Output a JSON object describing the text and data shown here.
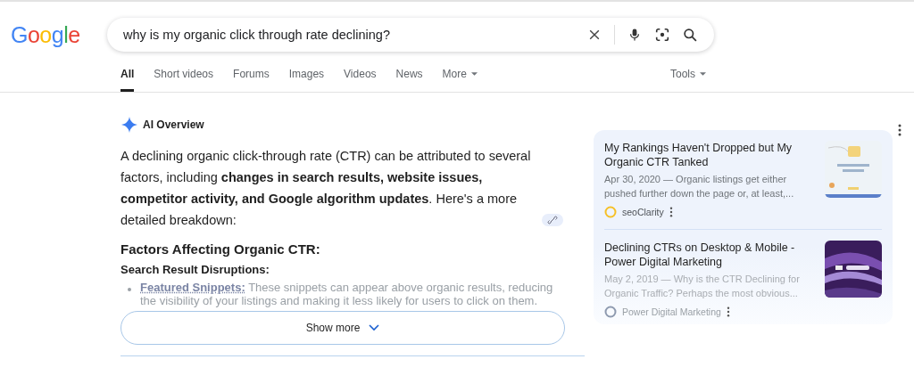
{
  "logo": "Google",
  "search": {
    "value": "why is my organic click through rate declining?"
  },
  "tabs": [
    {
      "label": "All",
      "selected": true,
      "dropdown": false
    },
    {
      "label": "Short videos",
      "selected": false,
      "dropdown": false
    },
    {
      "label": "Forums",
      "selected": false,
      "dropdown": false
    },
    {
      "label": "Images",
      "selected": false,
      "dropdown": false
    },
    {
      "label": "Videos",
      "selected": false,
      "dropdown": false
    },
    {
      "label": "News",
      "selected": false,
      "dropdown": false
    },
    {
      "label": "More",
      "selected": false,
      "dropdown": true
    }
  ],
  "tools": "Tools",
  "overview": {
    "title": "AI Overview",
    "intro": "A declining organic click-through rate (CTR) can be attributed to several factors, including **changes in search results, website issues, competitor activity, and Google algorithm updates**. Here's a more detailed breakdown:",
    "heading": "Factors Affecting Organic CTR:",
    "subheading": "Search Result Disruptions:",
    "bullets": [
      {
        "term": "Featured Snippets:",
        "text": "These snippets can appear above organic results, reducing the visibility of your listings and making it less likely for users to click on them."
      }
    ],
    "show_more": "Show more"
  },
  "sources": [
    {
      "title": "My Rankings Haven't Dropped but My Organic CTR Tanked",
      "snippet": "Apr 30, 2020 — Organic listings get either pushed further down the page or, at least,...",
      "site": "seoClarity",
      "faded": false,
      "color": "#f6c026",
      "kind": "light"
    },
    {
      "title": "Declining CTRs on Desktop & Mobile - Power Digital Marketing",
      "snippet": "May 2, 2019 — Why is the CTR Declining for Organic Traffic? Perhaps the most obvious...",
      "site": "Power Digital Marketing",
      "faded": true,
      "color": "#8e9aaf",
      "kind": "dark"
    }
  ]
}
